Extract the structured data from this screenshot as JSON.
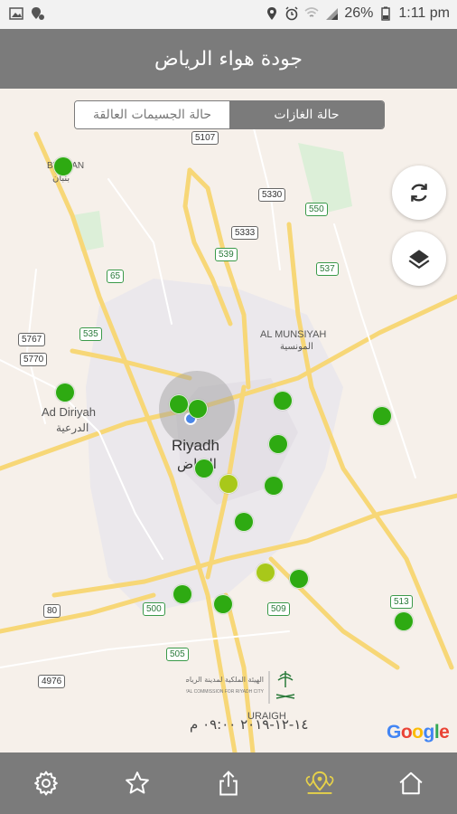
{
  "status_bar": {
    "battery": "26%",
    "time": "1:11 pm"
  },
  "header": {
    "title": "جودة هواء الرياض"
  },
  "toggle": {
    "particles_label": "حالة الجسيمات العالقة",
    "gases_label": "حالة الغازات",
    "selected": "gases"
  },
  "map": {
    "labels": {
      "riyadh_en": "Riyadh",
      "riyadh_ar": "الرياض",
      "diriyah_en": "Ad Diriyah",
      "diriyah_ar": "الدرعية",
      "munsiyah_en": "AL MUNSIYAH",
      "munsiyah_ar": "المونسية",
      "benban_en": "BENBAN",
      "benban_ar": "بنبان",
      "uraigh_en": "URAIGH"
    },
    "road_shields": [
      "5107",
      "5330",
      "550",
      "5333",
      "539",
      "537",
      "65",
      "535",
      "5767",
      "5770",
      "513",
      "509",
      "500",
      "505",
      "80",
      "4976"
    ],
    "marker_colors": {
      "good": "#2eaa12",
      "moderate": "#a8c81a"
    },
    "station_statuses": [
      "good",
      "good",
      "good",
      "good",
      "good",
      "good",
      "good",
      "good",
      "good",
      "moderate",
      "good",
      "good",
      "moderate",
      "good",
      "good",
      "good",
      "good"
    ]
  },
  "watermark": {
    "org_ar": "الهيئة الملكية لمدينة الرياض",
    "org_en": "ROYAL COMMISSION FOR RIYADH CITY",
    "timestamp": "١٤-١٢-٢٠١٩ ٠٩:٠٠ م"
  },
  "google_logo": "Google",
  "nav": {
    "items": [
      {
        "icon": "gear-icon"
      },
      {
        "icon": "star-icon"
      },
      {
        "icon": "share-icon"
      },
      {
        "icon": "map-pins-icon",
        "active": true
      },
      {
        "icon": "home-icon"
      }
    ],
    "active_color": "#e6d14a"
  }
}
